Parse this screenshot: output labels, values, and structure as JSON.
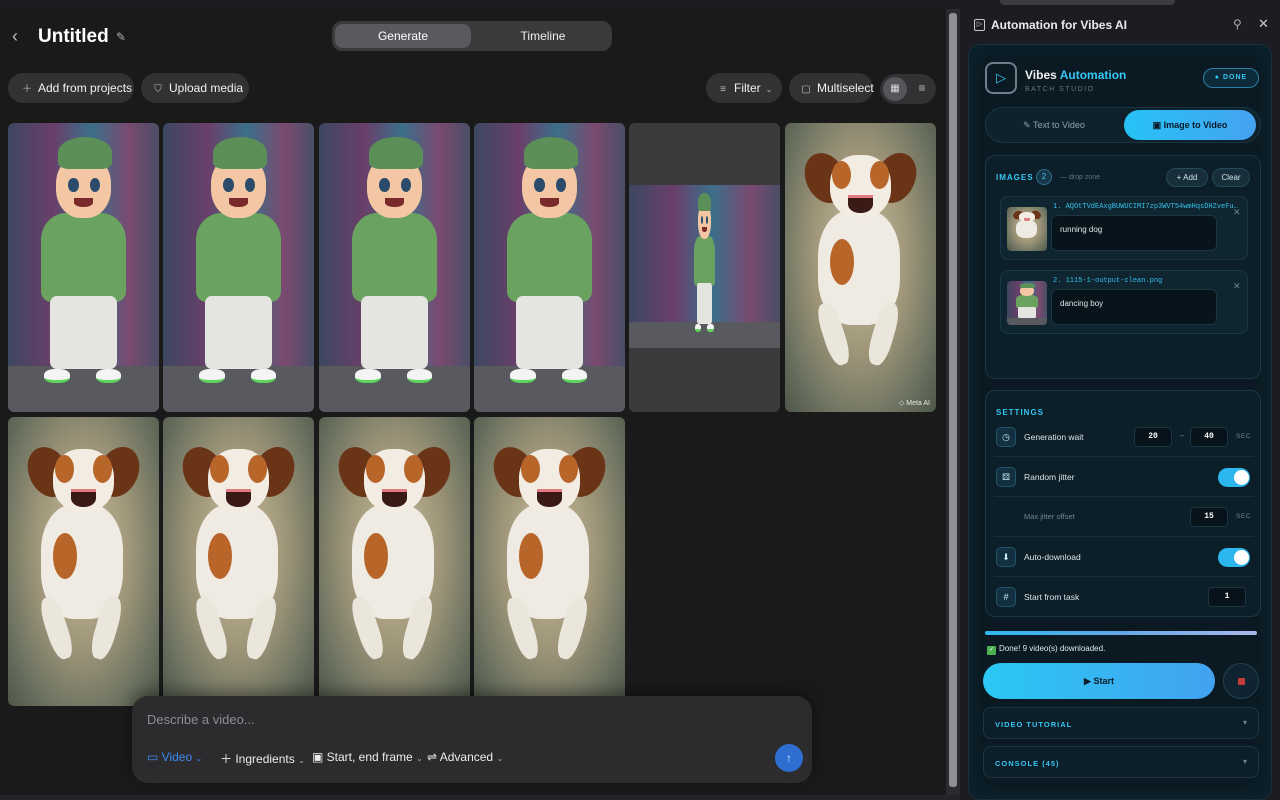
{
  "header": {
    "title": "Untitled",
    "tabs": [
      "Generate",
      "Timeline"
    ]
  },
  "toolbar": {
    "add_projects": "Add from projects",
    "upload": "Upload media",
    "filter": "Filter",
    "multiselect": "Multiselect"
  },
  "gallery": {
    "watermark": "Meta AI"
  },
  "composer": {
    "placeholder": "Describe a video...",
    "video": "Video",
    "ingredients": "Ingredients",
    "frames": "Start, end frame",
    "advanced": "Advanced"
  },
  "panel": {
    "title": "Automation for Vibes AI",
    "brand_name": "Vibes",
    "brand_accent": "Automation",
    "brand_sub": "BATCH STUDIO",
    "badge": "DONE",
    "mode_text": "Text to Video",
    "mode_image": "Image to Video",
    "images": {
      "title": "IMAGES",
      "count": "2",
      "hint": "— drop zone",
      "add": "+ Add",
      "clear": "Clear",
      "items": [
        {
          "file": "1. AQOtTVdEAxgBUWUCIMI7zp3WVT54wmHqsDHZveFu…",
          "caption": "running dog"
        },
        {
          "file": "2. 1115-1-output-clean.png",
          "caption": "dancing boy"
        }
      ]
    },
    "settings": {
      "title": "SETTINGS",
      "gen_wait": "Generation wait",
      "wait_min": "20",
      "dash": "–",
      "wait_max": "40",
      "unit": "SEC",
      "jitter": "Random jitter",
      "max_jitter": "Max jitter offset",
      "jitter_val": "15",
      "auto_dl": "Auto-download",
      "start_task": "Start from task",
      "start_val": "1"
    },
    "progress": 1.0,
    "status": "Done! 9 video(s) downloaded.",
    "start": "Start",
    "tutorial": "VIDEO TUTORIAL",
    "console": "CONSOLE (45)"
  },
  "colors": {
    "accent": "#35c7f5",
    "send": "#2f6ed1",
    "stop": "#c33a3a",
    "check": "#4caf50"
  }
}
